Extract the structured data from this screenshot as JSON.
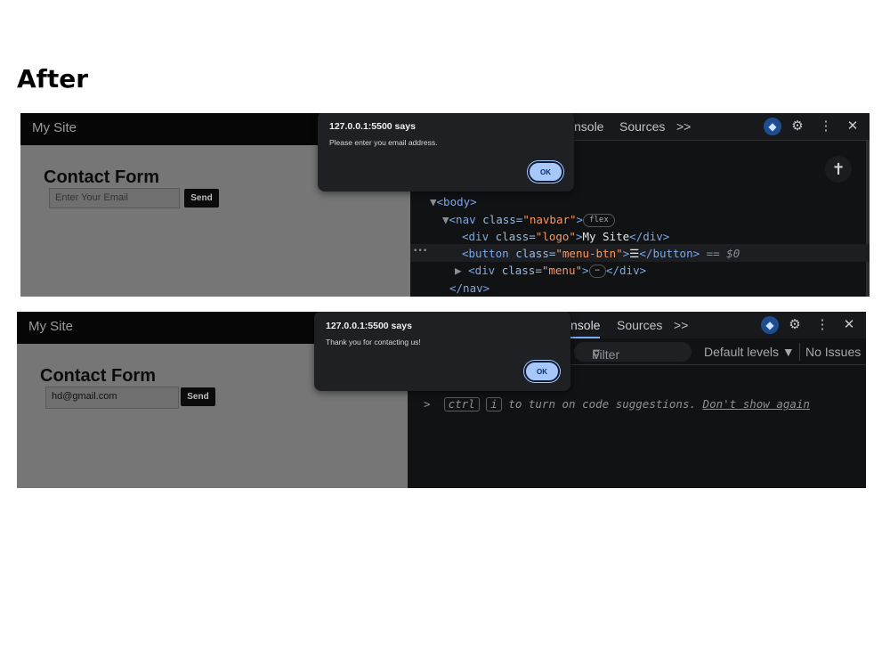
{
  "heading": "After",
  "screens": [
    {
      "site": {
        "logo": "My Site",
        "form_title": "Contact Form",
        "email_placeholder": "Enter Your Email",
        "email_value": "",
        "send_label": "Send"
      },
      "dialog": {
        "title": "127.0.0.1:5500 says",
        "message": "Please enter you email address.",
        "ok_label": "OK"
      },
      "devtools": {
        "tabs": [
          "nsole",
          "Sources",
          ">>"
        ],
        "elements": {
          "body_tag": "<body>",
          "nav_open": "<nav ",
          "nav_attr": "class=",
          "nav_val": "\"navbar\"",
          "nav_close": ">",
          "flex_pill": "flex",
          "div_logo_open": "<div ",
          "div_logo_attr": "class=",
          "div_logo_val": "\"logo\"",
          "div_logo_gt": ">",
          "div_logo_text": "My Site",
          "div_logo_end": "</div>",
          "button_open": "<button ",
          "button_attr": "class=",
          "button_val": "\"menu-btn\"",
          "button_gt": ">",
          "button_text": "☰",
          "button_end": "</button>",
          "button_suffix": " == $0",
          "div_menu_open": "<div ",
          "div_menu_attr": "class=",
          "div_menu_val": "\"menu\"",
          "div_menu_gt": ">",
          "div_menu_ellipsis": "⋯",
          "div_menu_end": "</div>",
          "nav_end": "</nav>",
          "row_dots": "•••"
        }
      }
    },
    {
      "site": {
        "logo": "My Site",
        "form_title": "Contact Form",
        "email_placeholder": "",
        "email_value": "hd@gmail.com",
        "send_label": "Send"
      },
      "dialog": {
        "title": "127.0.0.1:5500 says",
        "message": "Thank you for contacting us!",
        "ok_label": "OK"
      },
      "devtools": {
        "tabs": [
          "nsole",
          "Sources",
          ">>"
        ],
        "console": {
          "filter_placeholder": "Filter",
          "levels_label": "Default levels ▼",
          "issues_label": "No Issues",
          "prompt": ">",
          "kbd_ctrl": "ctrl",
          "kbd_i": "i",
          "hint_text": " to turn on code suggestions. ",
          "dont_show": "Don't show again"
        }
      }
    }
  ],
  "icons": [
    "ai-assist-icon",
    "gear-icon",
    "kebab-menu-icon",
    "close-icon",
    "accessibility-icon",
    "filter-icon"
  ]
}
